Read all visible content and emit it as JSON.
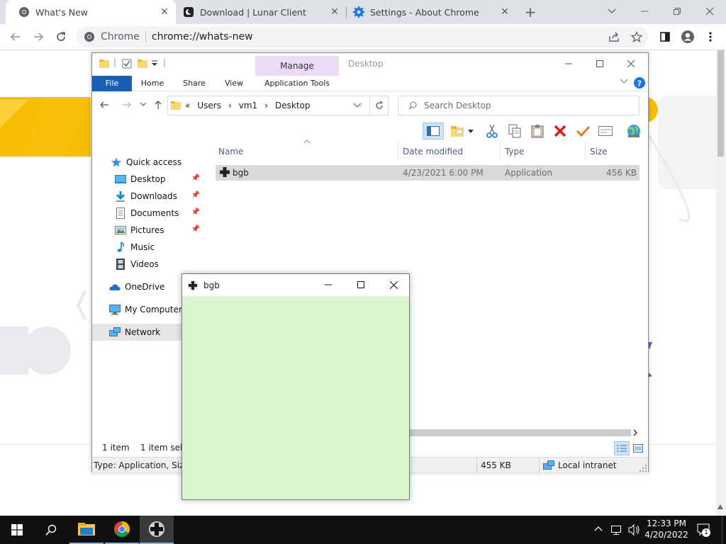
{
  "browser": {
    "tabs": [
      {
        "title": "What's New",
        "active": true
      },
      {
        "title": "Download | Lunar Client",
        "active": false
      },
      {
        "title": "Settings - About Chrome",
        "active": false
      }
    ],
    "omnibox": {
      "site_label": "Chrome",
      "url": "chrome://whats-new"
    }
  },
  "explorer": {
    "quick_access_toolbar_divider": "|",
    "contextual_tab_group": "Manage",
    "window_title": "Desktop",
    "ribbon_tabs": [
      "File",
      "Home",
      "Share",
      "View",
      "Application Tools"
    ],
    "address": {
      "overflow": "«",
      "crumbs": [
        "Users",
        "vm1",
        "Desktop"
      ]
    },
    "search_placeholder": "Search Desktop",
    "nav": {
      "quick_access": "Quick access",
      "desktop": "Desktop",
      "downloads": "Downloads",
      "documents": "Documents",
      "pictures": "Pictures",
      "music": "Music",
      "videos": "Videos",
      "onedrive": "OneDrive",
      "my_computer": "My Computer",
      "network": "Network"
    },
    "columns": [
      "Name",
      "Date modified",
      "Type",
      "Size"
    ],
    "files": [
      {
        "name": "bgb",
        "date_modified": "4/23/2021 6:00 PM",
        "type": "Application",
        "size": "456 KB"
      }
    ],
    "status": {
      "item_count": "1 item",
      "selected": "1 item selec"
    },
    "bottom": {
      "details": "Type: Application, Size: 4",
      "size": "455 KB",
      "zone": "Local intranet"
    }
  },
  "bgb_window": {
    "title": "bgb"
  },
  "taskbar": {
    "time": "12:33 PM",
    "date": "4/20/2022",
    "notifications": "1"
  },
  "colors": {
    "bgb_client": "#dcf5d1",
    "file_tab": "#1a5fb4",
    "manage_tab": "#eadcf6",
    "selected_row": "#d9d9d9"
  }
}
